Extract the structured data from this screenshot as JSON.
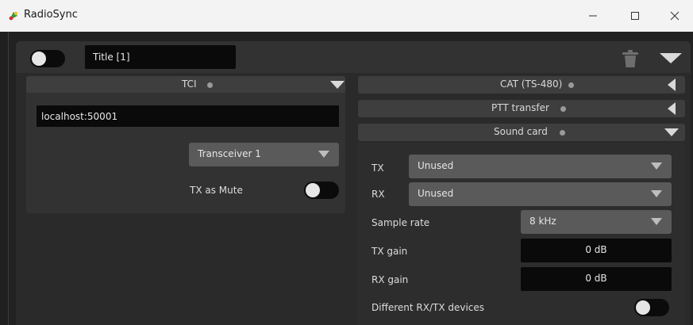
{
  "window": {
    "title": "RadioSync",
    "icon": "radio-sync-logo-icon",
    "buttons": {
      "minimize": "minimize-icon",
      "maximize": "maximize-icon",
      "close": "close-icon"
    }
  },
  "instance": {
    "enabled": false,
    "title_value": "Title [1]",
    "delete_icon": "trash-icon",
    "collapse_icon": "chevron-down-icon"
  },
  "tci": {
    "label": "TCI",
    "address_value": "localhost:50001",
    "transceiver": "Transceiver 1",
    "tx_as_mute_label": "TX as Mute",
    "tx_as_mute_on": false
  },
  "cat": {
    "label": "CAT (TS-480)",
    "expanded": false
  },
  "ptt": {
    "label": "PTT transfer",
    "expanded": false
  },
  "sound_card": {
    "label": "Sound card",
    "expanded": true,
    "tx_label": "TX",
    "tx_device": "Unused",
    "rx_label": "RX",
    "rx_device": "Unused",
    "sample_rate_label": "Sample rate",
    "sample_rate": "8 kHz",
    "tx_gain_label": "TX gain",
    "tx_gain": "0 dB",
    "rx_gain_label": "RX gain",
    "rx_gain": "0 dB",
    "diff_devices_label": "Different RX/TX devices",
    "diff_devices_on": false
  },
  "colors": {
    "background": "#1f1f1f",
    "panel": "#323232",
    "header": "#3e3e3e",
    "dropdown": "#5a5a5a",
    "field": "#0a0a0a",
    "text": "#e6e6e6",
    "status_dot": "#9a9a9a"
  }
}
